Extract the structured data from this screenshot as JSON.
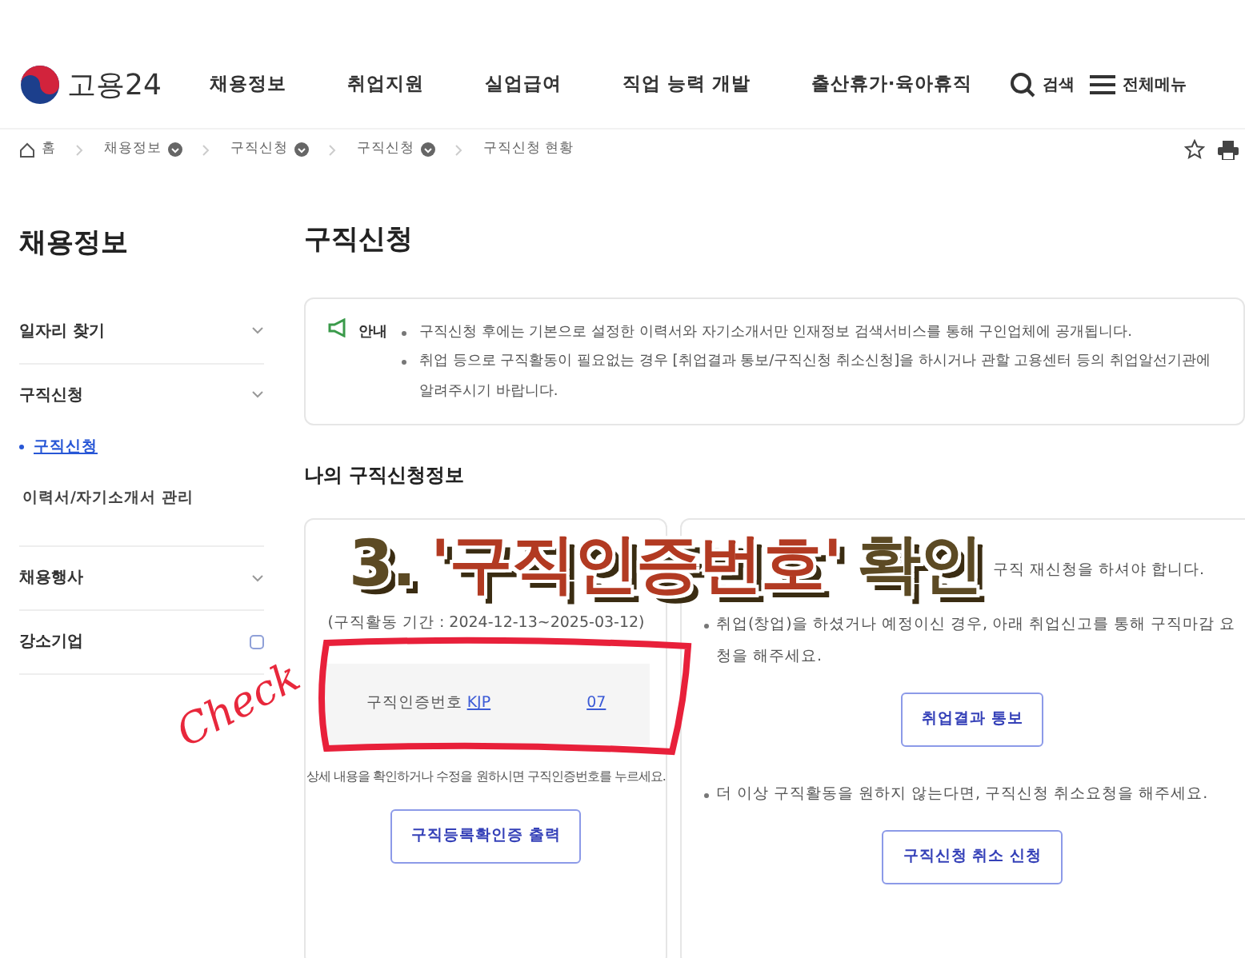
{
  "header": {
    "logo": "고용24",
    "nav": [
      "채용정보",
      "취업지원",
      "실업급여",
      "직업 능력 개발",
      "출산휴가·육아휴직"
    ],
    "search": "검색",
    "menu": "전체메뉴"
  },
  "breadcrumb": [
    {
      "label": "홈",
      "kind": "home"
    },
    {
      "label": "채용정보",
      "kind": "dropdown"
    },
    {
      "label": "구직신청",
      "kind": "dropdown"
    },
    {
      "label": "구직신청",
      "kind": "dropdown"
    },
    {
      "label": "구직신청 현황",
      "kind": "plain"
    }
  ],
  "sidebar": {
    "title": "채용정보",
    "items": [
      {
        "label": "일자리 찾기",
        "kind": "menu"
      },
      {
        "label": "구직신청",
        "kind": "menu",
        "children": [
          {
            "label": "구직신청",
            "selected": true
          },
          {
            "label": "이력서/자기소개서 관리",
            "selected": false
          }
        ]
      },
      {
        "label": "채용행사",
        "kind": "menu"
      },
      {
        "label": "강소기업",
        "kind": "external"
      }
    ]
  },
  "page_title": "구직신청",
  "notice": {
    "label": "안내",
    "items": [
      "구직신청 후에는 기본으로 설정한 이력서와 자기소개서만 인재정보 검색서비스를 통해 구인업체에 공개됩니다.",
      "취업 등으로 구직활동이 필요없는 경우 [취업결과 통보/구직신청 취소신청]을 하시거나 관할 고용센터 등의 취업알선기관에 알려주시기 바랍니다."
    ]
  },
  "section_title": "나의 구직신청정보",
  "left_card": {
    "period": "(구직활동 기간 : 2024-12-13~2025-03-12)",
    "cert_label": "구직인증번호",
    "cert_start": "KJP",
    "cert_end": "07",
    "hint": "상세 내용을 확인하거나 수정을 원하시면 구직인증번호를 누르세요.",
    "button": "구직등록확인증 출력"
  },
  "right_card": {
    "items": [
      {
        "text": "구직 재신청을 하셔야 합니다.",
        "bullet": false
      },
      {
        "text": "취업(창업)을 하셨거나 예정이신 경우, 아래 취업신고를 통해 구직마감 요청을 해주세요.",
        "bullet": true,
        "button": "취업결과 통보"
      },
      {
        "text": "더 이상 구직활동을 원하지 않는다면, 구직신청 취소요청을 해주세요.",
        "bullet": true,
        "button": "구직신청 취소 신청"
      }
    ]
  },
  "annotation": {
    "parts": [
      {
        "text": "3.",
        "color": "#5c4a24"
      },
      {
        "text": "'구직인증번호'",
        "color": "#b23a22"
      },
      {
        "text": "확인",
        "color": "#5c4a24"
      }
    ],
    "handwriting": "Check"
  }
}
